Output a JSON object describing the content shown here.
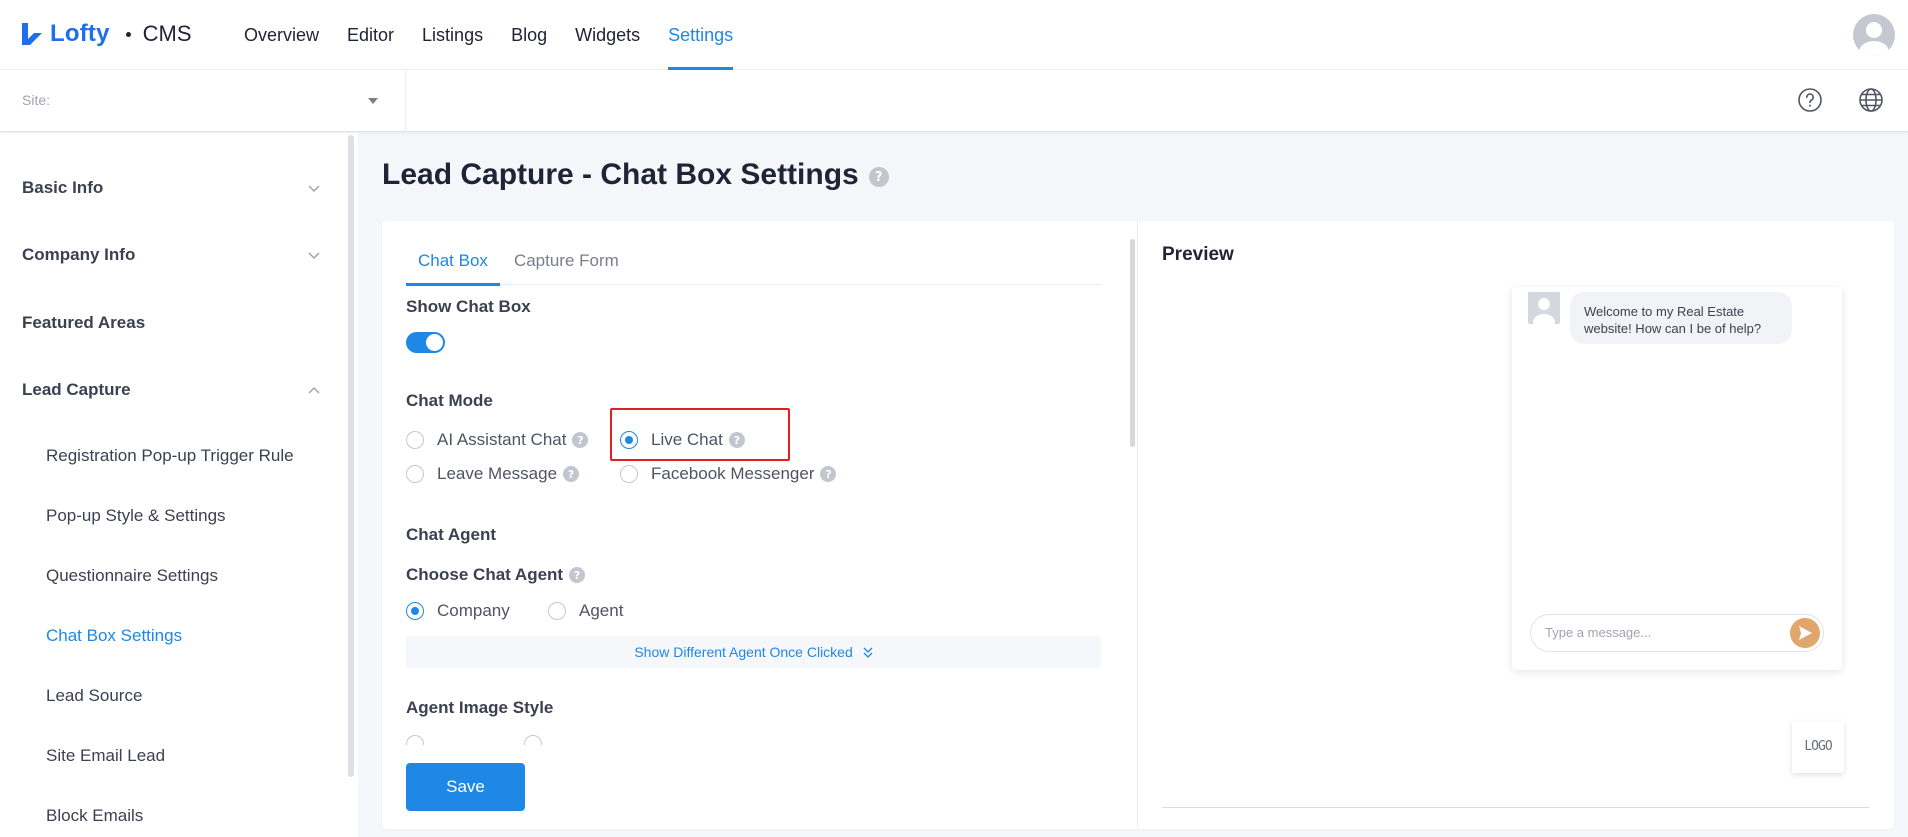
{
  "brand": {
    "name": "Lofty",
    "product": "CMS"
  },
  "nav": [
    {
      "label": "Overview",
      "active": false
    },
    {
      "label": "Editor",
      "active": false
    },
    {
      "label": "Listings",
      "active": false
    },
    {
      "label": "Blog",
      "active": false
    },
    {
      "label": "Widgets",
      "active": false
    },
    {
      "label": "Settings",
      "active": true
    }
  ],
  "subbar": {
    "site_label": "Site:"
  },
  "sidebar": {
    "groups": [
      {
        "label": "Basic Info",
        "expanded": false
      },
      {
        "label": "Company Info",
        "expanded": false
      },
      {
        "label": "Featured Areas"
      },
      {
        "label": "Lead Capture",
        "expanded": true
      }
    ],
    "lead_capture_items": [
      {
        "label": "Registration Pop-up Trigger Rule",
        "active": false
      },
      {
        "label": "Pop-up Style & Settings",
        "active": false
      },
      {
        "label": "Questionnaire Settings",
        "active": false
      },
      {
        "label": "Chat Box Settings",
        "active": true
      },
      {
        "label": "Lead Source",
        "active": false
      },
      {
        "label": "Site Email Lead",
        "active": false
      },
      {
        "label": "Block Emails",
        "active": false
      }
    ]
  },
  "page": {
    "title": "Lead Capture - Chat Box Settings"
  },
  "tabs": [
    {
      "label": "Chat Box",
      "active": true
    },
    {
      "label": "Capture Form",
      "active": false
    }
  ],
  "form": {
    "show_chat_box_label": "Show Chat Box",
    "show_chat_box_on": true,
    "chat_mode_label": "Chat Mode",
    "chat_mode_options": {
      "ai": "AI Assistant Chat",
      "live": "Live Chat",
      "leave": "Leave Message",
      "facebook": "Facebook Messenger"
    },
    "chat_mode_selected": "Live Chat",
    "chat_agent_label": "Chat Agent",
    "choose_agent_label": "Choose Chat Agent",
    "agent_options": {
      "company": "Company",
      "agent": "Agent"
    },
    "agent_selected": "Company",
    "show_different_agent": "Show Different Agent Once Clicked",
    "agent_image_style_label": "Agent Image Style",
    "save_label": "Save"
  },
  "preview": {
    "title": "Preview",
    "welcome_message": "Welcome to my Real Estate website! How can I be of help?",
    "input_placeholder": "Type a message...",
    "logo_text": "LOGO"
  },
  "colors": {
    "accent": "#1f87e5",
    "highlight": "#e02020",
    "send_button": "#e0a66b"
  },
  "icons": [
    "lofty-logo-icon",
    "chevron-down-icon",
    "chevron-up-icon",
    "help-circle-icon",
    "globe-icon",
    "question-icon",
    "double-chevron-down-icon",
    "send-icon",
    "user-avatar-icon"
  ]
}
